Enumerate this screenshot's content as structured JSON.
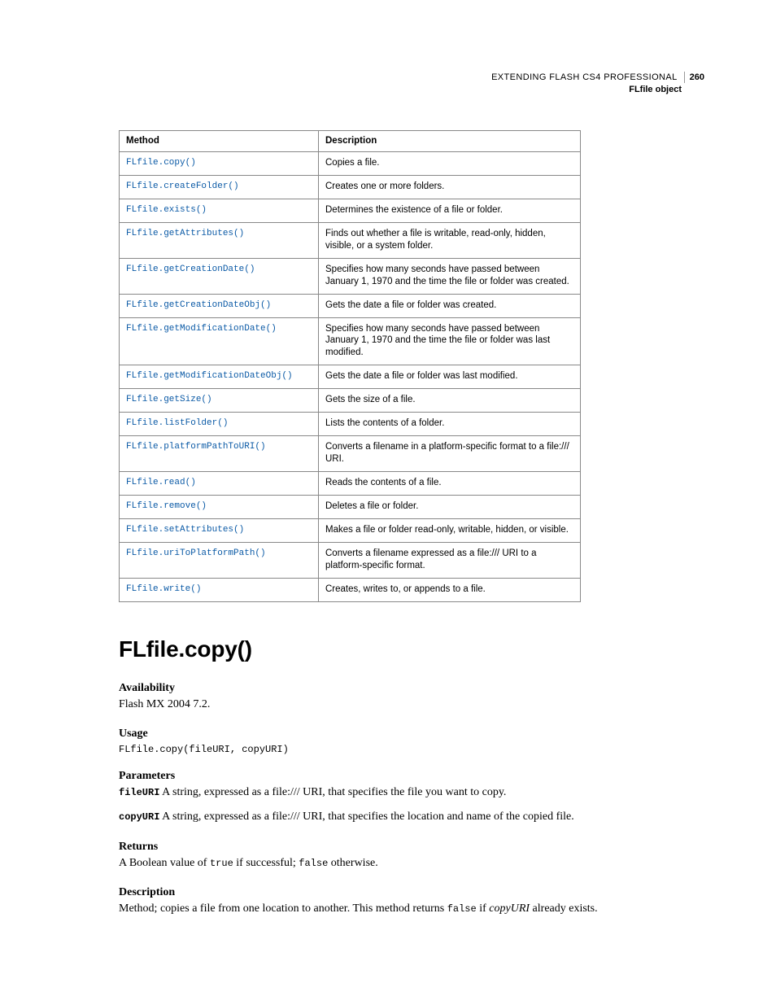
{
  "header": {
    "book": "EXTENDING FLASH CS4 PROFESSIONAL",
    "page": "260",
    "section": "FLfile object"
  },
  "table": {
    "col_method": "Method",
    "col_description": "Description",
    "rows": [
      {
        "method": "FLfile.copy()",
        "desc": "Copies a file."
      },
      {
        "method": "FLfile.createFolder()",
        "desc": "Creates one or more folders."
      },
      {
        "method": "FLfile.exists()",
        "desc": "Determines the existence of a file or folder."
      },
      {
        "method": "FLfile.getAttributes()",
        "desc": "Finds out whether a file is writable, read-only, hidden, visible, or a system folder."
      },
      {
        "method": "FLfile.getCreationDate()",
        "desc": "Specifies how many seconds have passed between January 1, 1970 and the time the file or folder was created."
      },
      {
        "method": "FLfile.getCreationDateObj()",
        "desc": "Gets the date a file or folder was created."
      },
      {
        "method": "FLfile.getModificationDate()",
        "desc": "Specifies how many seconds have passed between January 1, 1970 and the time the file or folder was last modified."
      },
      {
        "method": "FLfile.getModificationDateObj()",
        "desc": "Gets the date a file or folder was last modified."
      },
      {
        "method": "FLfile.getSize()",
        "desc": "Gets the size of a file."
      },
      {
        "method": "FLfile.listFolder()",
        "desc": "Lists the contents of a folder."
      },
      {
        "method": "FLfile.platformPathToURI()",
        "desc": "Converts a filename in a platform-specific format to a file:/// URI."
      },
      {
        "method": "FLfile.read()",
        "desc": "Reads the contents of a file."
      },
      {
        "method": "FLfile.remove()",
        "desc": "Deletes a file or folder."
      },
      {
        "method": "FLfile.setAttributes()",
        "desc": "Makes a file or folder read-only, writable, hidden, or visible."
      },
      {
        "method": "FLfile.uriToPlatformPath()",
        "desc": "Converts a filename expressed as a file:/// URI to a platform-specific format."
      },
      {
        "method": "FLfile.write()",
        "desc": "Creates, writes to, or appends to a file."
      }
    ]
  },
  "detail": {
    "title": "FLfile.copy()",
    "availability": {
      "label": "Availability",
      "text": "Flash MX 2004 7.2."
    },
    "usage": {
      "label": "Usage",
      "code": "FLfile.copy(fileURI, copyURI)"
    },
    "parameters": {
      "label": "Parameters",
      "items": [
        {
          "name": "fileURI",
          "text": "A string, expressed as a file:/// URI, that specifies the file you want to copy."
        },
        {
          "name": "copyURI",
          "text": "A string, expressed as a file:/// URI, that specifies the location and name of the copied file."
        }
      ]
    },
    "returns": {
      "label": "Returns",
      "pre": "A Boolean value of ",
      "code1": "true",
      "mid": " if successful; ",
      "code2": "false",
      "post": " otherwise."
    },
    "description": {
      "label": "Description",
      "pre": "Method; copies a file from one location to another. This method returns ",
      "code": "false",
      "mid": " if ",
      "italic": "copyURI",
      "post": " already exists."
    }
  }
}
